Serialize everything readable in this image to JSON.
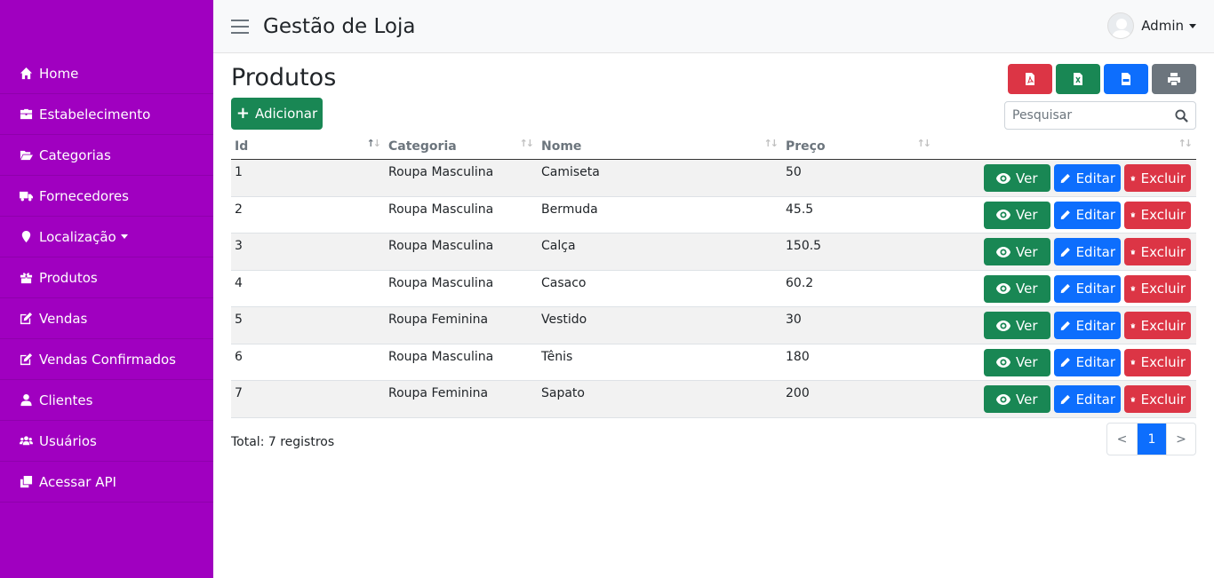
{
  "app": {
    "title": "Gestão de Loja"
  },
  "user": {
    "name": "Admin"
  },
  "sidebar": {
    "items": [
      {
        "label": "Home",
        "icon": "home-icon"
      },
      {
        "label": "Estabelecimento",
        "icon": "briefcase-icon"
      },
      {
        "label": "Categorias",
        "icon": "folder-open-icon"
      },
      {
        "label": "Fornecedores",
        "icon": "truck-icon"
      },
      {
        "label": "Localização",
        "icon": "map-marker-icon"
      },
      {
        "label": "Produtos",
        "icon": "gift-icon"
      },
      {
        "label": "Vendas",
        "icon": "edit-icon"
      },
      {
        "label": "Vendas Confirmados",
        "icon": "edit-icon"
      },
      {
        "label": "Clientes",
        "icon": "user-icon"
      },
      {
        "label": "Usuários",
        "icon": "users-icon"
      },
      {
        "label": "Acessar API",
        "icon": "clone-icon"
      }
    ]
  },
  "page": {
    "title": "Produtos",
    "add_label": "Adicionar",
    "search_placeholder": "Pesquisar",
    "total_label": "Total: 7 registros"
  },
  "table": {
    "headers": [
      "Id",
      "Categoria",
      "Nome",
      "Preço",
      ""
    ],
    "rows": [
      [
        "1",
        "Roupa Masculina",
        "Camiseta",
        "50"
      ],
      [
        "2",
        "Roupa Masculina",
        "Bermuda",
        "45.5"
      ],
      [
        "3",
        "Roupa Masculina",
        "Calça",
        "150.5"
      ],
      [
        "4",
        "Roupa Masculina",
        "Casaco",
        "60.2"
      ],
      [
        "5",
        "Roupa Feminina",
        "Vestido",
        "30"
      ],
      [
        "6",
        "Roupa Masculina",
        "Tênis",
        "180"
      ],
      [
        "7",
        "Roupa Feminina",
        "Sapato",
        "200"
      ]
    ],
    "actions": {
      "view": "Ver",
      "edit": "Editar",
      "delete": "Excluir"
    }
  },
  "pagination": {
    "prev": "<",
    "current": "1",
    "next": ">"
  },
  "colors": {
    "sidebar": "#a000c0",
    "success": "#198754",
    "primary": "#0d6efd",
    "danger": "#dc3545",
    "secondary": "#6c757d"
  }
}
